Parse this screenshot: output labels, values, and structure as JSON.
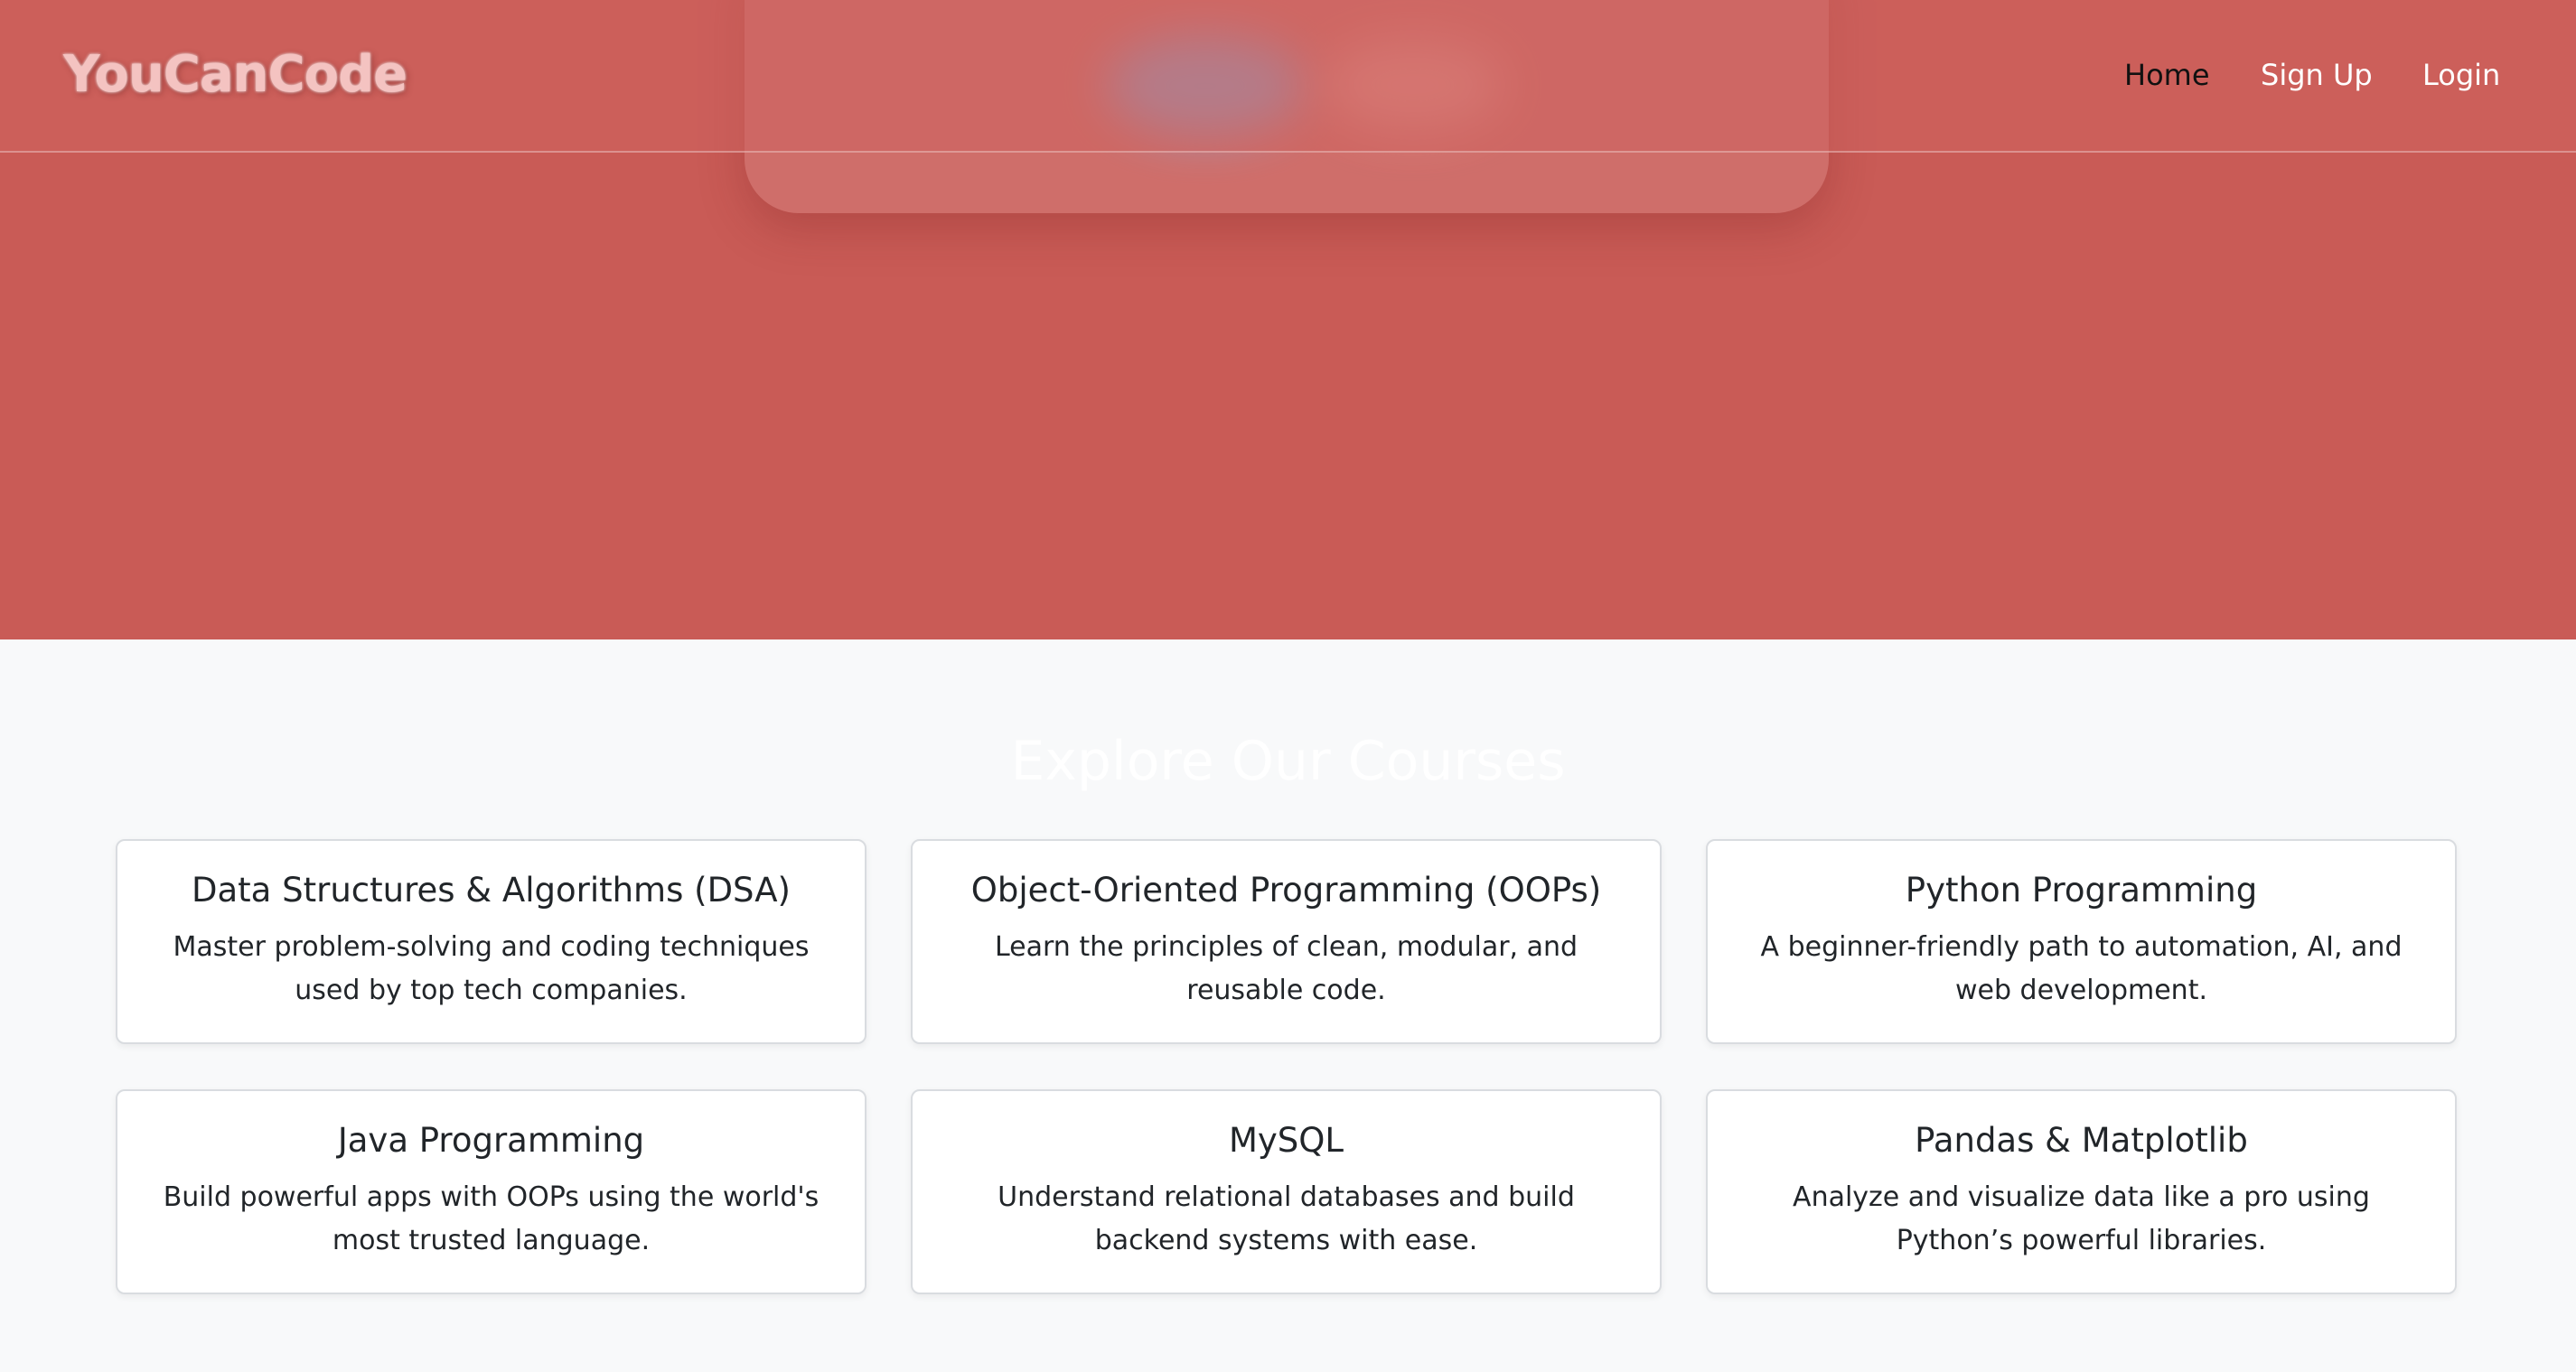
{
  "navbar": {
    "brand": "YouCanCode",
    "links": [
      {
        "label": "Home",
        "active": true
      },
      {
        "label": "Sign Up",
        "active": false
      },
      {
        "label": "Login",
        "active": false
      }
    ]
  },
  "courses": {
    "title": "Explore Our Courses",
    "items": [
      {
        "title": "Data Structures & Algorithms (DSA)",
        "description": "Master problem-solving and coding techniques used by top tech companies."
      },
      {
        "title": "Object-Oriented Programming (OOPs)",
        "description": "Learn the principles of clean, modular, and reusable code."
      },
      {
        "title": "Python Programming",
        "description": "A beginner-friendly path to automation, AI, and web development."
      },
      {
        "title": "Java Programming",
        "description": "Build powerful apps with OOPs using the world's most trusted language."
      },
      {
        "title": "MySQL",
        "description": "Understand relational databases and build backend systems with ease."
      },
      {
        "title": "Pandas & Matplotlib",
        "description": "Analyze and visualize data like a pro using Python’s powerful libraries."
      }
    ]
  },
  "colors": {
    "hero_background": "#c95b56",
    "page_background": "#f8f9fa",
    "card_background": "#ffffff",
    "text_dark": "#212529"
  }
}
